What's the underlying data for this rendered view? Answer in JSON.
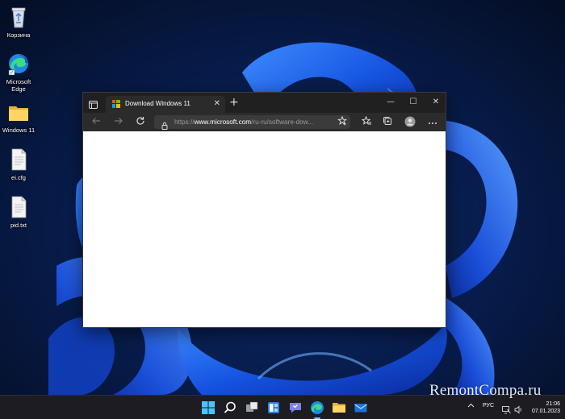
{
  "desktop": {
    "icons": [
      {
        "name": "recycle-bin",
        "label": "Корзина"
      },
      {
        "name": "microsoft-edge",
        "label_line1": "Microsoft",
        "label_line2": "Edge"
      },
      {
        "name": "folder",
        "label": "Windows 11"
      },
      {
        "name": "file-cfg",
        "label": "ei.cfg"
      },
      {
        "name": "file-txt",
        "label": "pid.txt"
      }
    ]
  },
  "browser": {
    "tab_title": "Download Windows 11",
    "tab_close": "✕",
    "new_tab": "+",
    "window_controls": {
      "minimize": "—",
      "maximize": "☐",
      "close": "✕"
    },
    "url_prefix": "https://",
    "url_domain": "www.microsoft.com",
    "url_path": "/ru-ru/software-dow..."
  },
  "taskbar": {
    "language": "РУС",
    "time": "21:06",
    "date": "07.01.2023"
  },
  "watermark": "RemontCompa.ru",
  "colors": {
    "accent": "#1a6cf0",
    "titlebar": "#202020",
    "toolbar": "#2b2b2b",
    "taskbar": "#1c1c22"
  }
}
